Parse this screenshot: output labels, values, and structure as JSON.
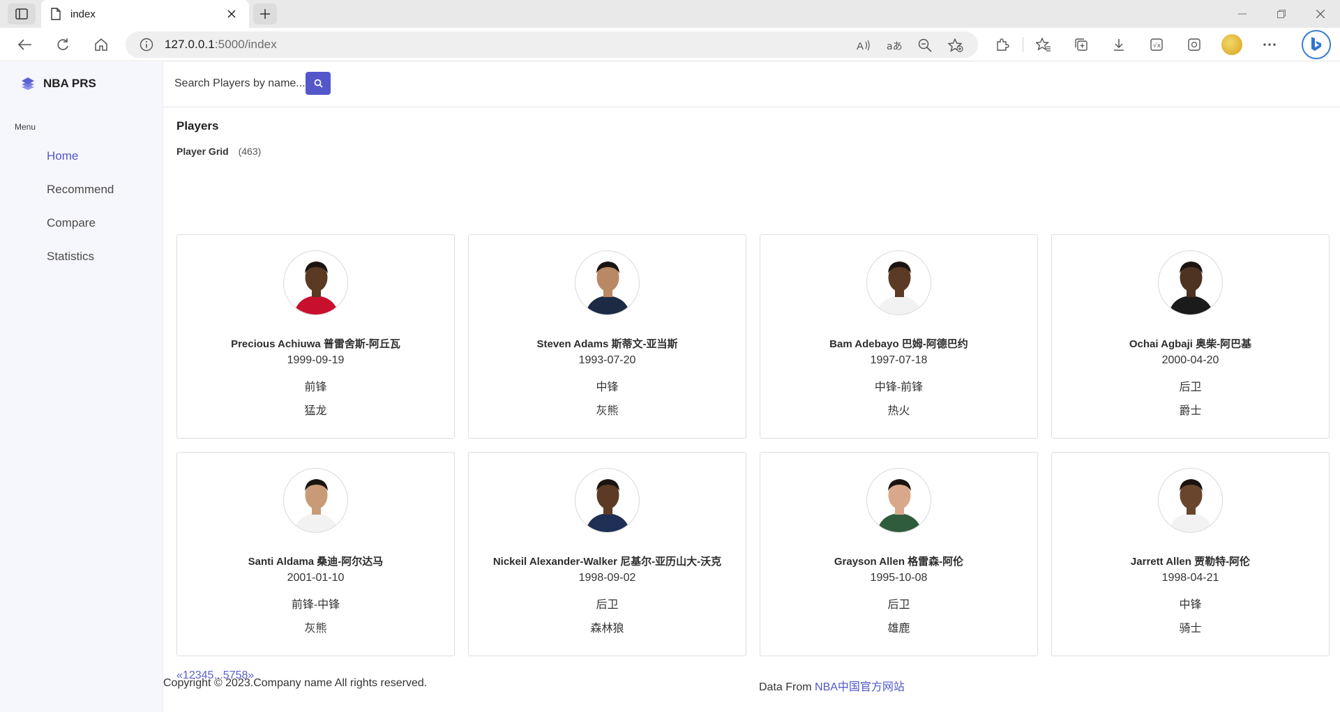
{
  "browser": {
    "tab_title": "index",
    "url_host": "127.0.0.1",
    "url_rest": ":5000/index"
  },
  "sidebar": {
    "brand": "NBA PRS",
    "menu_label": "Menu",
    "items": [
      {
        "label": "Home",
        "active": true
      },
      {
        "label": "Recommend",
        "active": false
      },
      {
        "label": "Compare",
        "active": false
      },
      {
        "label": "Statistics",
        "active": false
      }
    ]
  },
  "search": {
    "placeholder": "Search Players by name..."
  },
  "main": {
    "title": "Players",
    "grid_label": "Player Grid",
    "grid_count": "(463)"
  },
  "players": [
    {
      "name": "Precious Achiuwa 普雷舍斯-阿丘瓦",
      "birth": "1999-09-19",
      "position": "前锋",
      "team": "猛龙",
      "jersey": "#c8102e",
      "skin": "#5a3a22"
    },
    {
      "name": "Steven Adams 斯蒂文-亚当斯",
      "birth": "1993-07-20",
      "position": "中锋",
      "team": "灰熊",
      "jersey": "#1d2a44",
      "skin": "#b98864"
    },
    {
      "name": "Bam Adebayo 巴姆-阿德巴约",
      "birth": "1997-07-18",
      "position": "中锋-前锋",
      "team": "热火",
      "jersey": "#f2f2f2",
      "skin": "#5b3a26"
    },
    {
      "name": "Ochai Agbaji 奥柴-阿巴基",
      "birth": "2000-04-20",
      "position": "后卫",
      "team": "爵士",
      "jersey": "#1b1b1b",
      "skin": "#4e3222"
    },
    {
      "name": "Santi Aldama 桑迪-阿尔达马",
      "birth": "2001-01-10",
      "position": "前锋-中锋",
      "team": "灰熊",
      "jersey": "#f2f2f2",
      "skin": "#c89a78"
    },
    {
      "name": "Nickeil Alexander-Walker 尼基尔-亚历山大-沃克",
      "birth": "1998-09-02",
      "position": "后卫",
      "team": "森林狼",
      "jersey": "#1f2f55",
      "skin": "#5c3a26"
    },
    {
      "name": "Grayson Allen 格雷森-阿伦",
      "birth": "1995-10-08",
      "position": "后卫",
      "team": "雄鹿",
      "jersey": "#2f5c3c",
      "skin": "#d9a88a"
    },
    {
      "name": "Jarrett Allen 贾勒特-阿伦",
      "birth": "1998-04-21",
      "position": "中锋",
      "team": "骑士",
      "jersey": "#f2f2f2",
      "skin": "#6a452e"
    }
  ],
  "pagination": [
    "«",
    "1",
    "2",
    "3",
    "4",
    "5",
    "...",
    "57",
    "58",
    "»"
  ],
  "footer": {
    "copyright": "Copyright © 2023.Company name All rights reserved.",
    "data_from": "Data From ",
    "data_link": "NBA中国官方网站"
  }
}
